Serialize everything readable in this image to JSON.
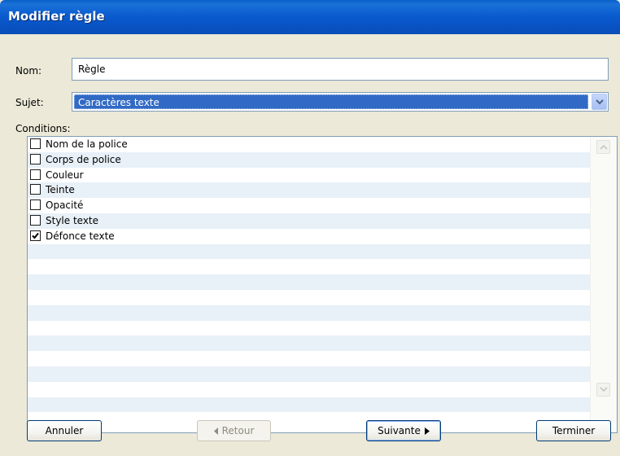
{
  "window": {
    "title": "Modifier règle"
  },
  "form": {
    "name_label": "Nom:",
    "name_value": "Règle",
    "subject_label": "Sujet:",
    "subject_value": "Caractères texte",
    "conditions_label": "Conditions:"
  },
  "conditions": [
    {
      "label": "Nom de la police",
      "checked": false
    },
    {
      "label": "Corps de police",
      "checked": false
    },
    {
      "label": "Couleur",
      "checked": false
    },
    {
      "label": "Teinte",
      "checked": false
    },
    {
      "label": "Opacité",
      "checked": false
    },
    {
      "label": "Style texte",
      "checked": false
    },
    {
      "label": "Défonce texte",
      "checked": true
    }
  ],
  "buttons": {
    "cancel": "Annuler",
    "back": "Retour",
    "next": "Suivante",
    "finish": "Terminer"
  },
  "icons": {
    "dropdown": "chevron-down-icon",
    "scroll_up": "chevron-up-icon",
    "scroll_down": "chevron-down-icon",
    "back_arrow": "triangle-left-icon",
    "next_arrow": "triangle-right-icon",
    "checkmark": "checkmark-icon"
  },
  "colors": {
    "titlebar": "#0b5cd0",
    "selection": "#316ac5",
    "face": "#ece9d8",
    "row_alt": "#e8f0f8"
  }
}
